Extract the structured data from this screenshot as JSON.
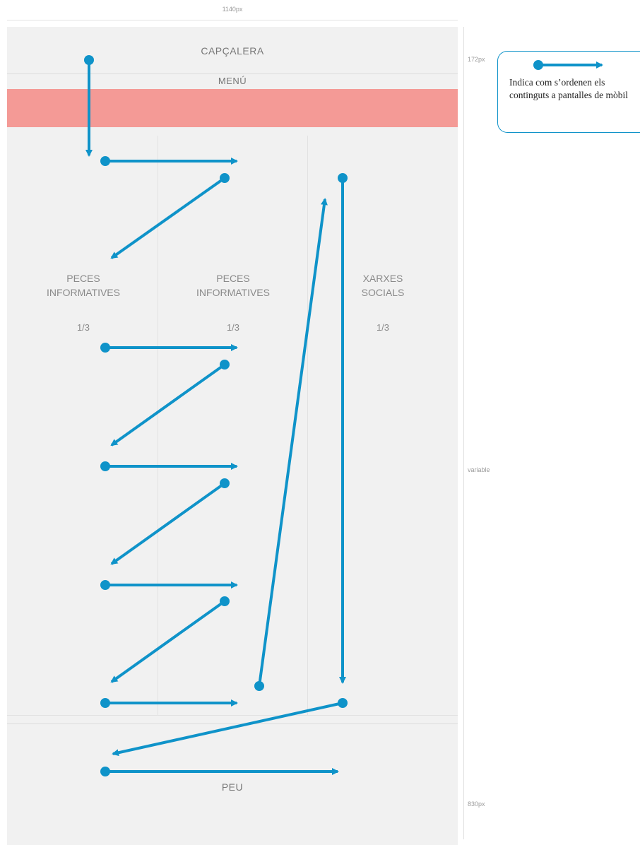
{
  "dimensions": {
    "width_label": "1140px",
    "header_height_label": "172px",
    "content_height_label": "variable",
    "footer_height_label": "830px"
  },
  "layout": {
    "header": "CAPÇALERA",
    "menu": "MENÚ",
    "columns": [
      {
        "title_line1": "PECES",
        "title_line2": "INFORMATIVES",
        "fraction": "1/3"
      },
      {
        "title_line1": "PECES",
        "title_line2": "INFORMATIVES",
        "fraction": "1/3"
      },
      {
        "title_line1": "XARXES",
        "title_line2": "SOCIALS",
        "fraction": "1/3"
      }
    ],
    "footer": "PEU"
  },
  "legend": {
    "text": "Indica com s’ordenen els continguts a pantalles de mòbil"
  },
  "colors": {
    "arrow": "#0f93c9",
    "menu_bar": "#f49a96",
    "frame": "#f1f1f1"
  }
}
